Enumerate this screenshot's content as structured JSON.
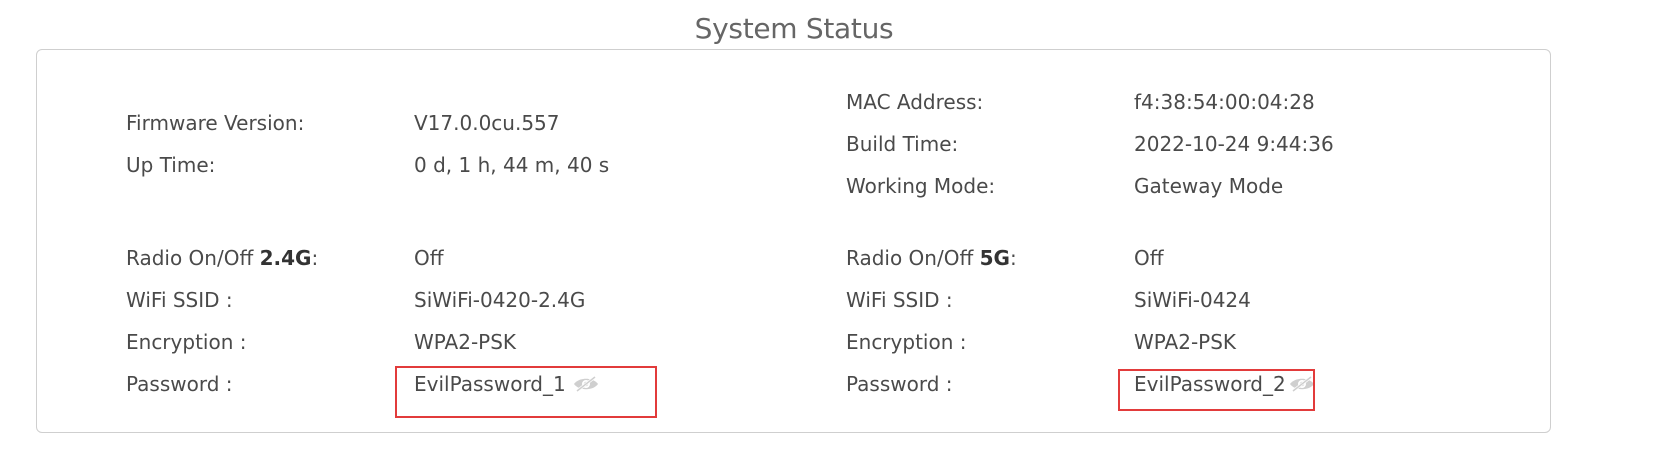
{
  "title": "System Status",
  "left_top": [
    {
      "label": "Firmware Version:",
      "value": "V17.0.0cu.557"
    },
    {
      "label": "Up Time:",
      "value": "0 d, 1 h, 44 m, 40 s"
    }
  ],
  "right_top": [
    {
      "label": "MAC Address:",
      "value": "f4:38:54:00:04:28"
    },
    {
      "label": "Build Time:",
      "value": "2022-10-24 9:44:36"
    },
    {
      "label": "Working Mode:",
      "value": "Gateway Mode"
    }
  ],
  "wifi_24": {
    "radio_label_prefix": "Radio On/Off ",
    "radio_band": "2.4G",
    "radio_label_suffix": ":",
    "radio_value": "Off",
    "ssid_label": "WiFi SSID :",
    "ssid_value": "SiWiFi-0420-2.4G",
    "enc_label": "Encryption :",
    "enc_value": "WPA2-PSK",
    "pw_label": "Password :",
    "pw_value": "EvilPassword_1",
    "pw_icon": "eye-slash-icon"
  },
  "wifi_5": {
    "radio_label_prefix": "Radio On/Off ",
    "radio_band": "5G",
    "radio_label_suffix": ":",
    "radio_value": "Off",
    "ssid_label": "WiFi SSID :",
    "ssid_value": "SiWiFi-0424",
    "enc_label": "Encryption :",
    "enc_value": "WPA2-PSK",
    "pw_label": "Password :",
    "pw_value": "EvilPassword_2",
    "pw_icon": "eye-slash-icon"
  },
  "colors": {
    "highlight": "#e23b3b",
    "border": "#cfcfcf",
    "text": "#4a4a4a"
  }
}
